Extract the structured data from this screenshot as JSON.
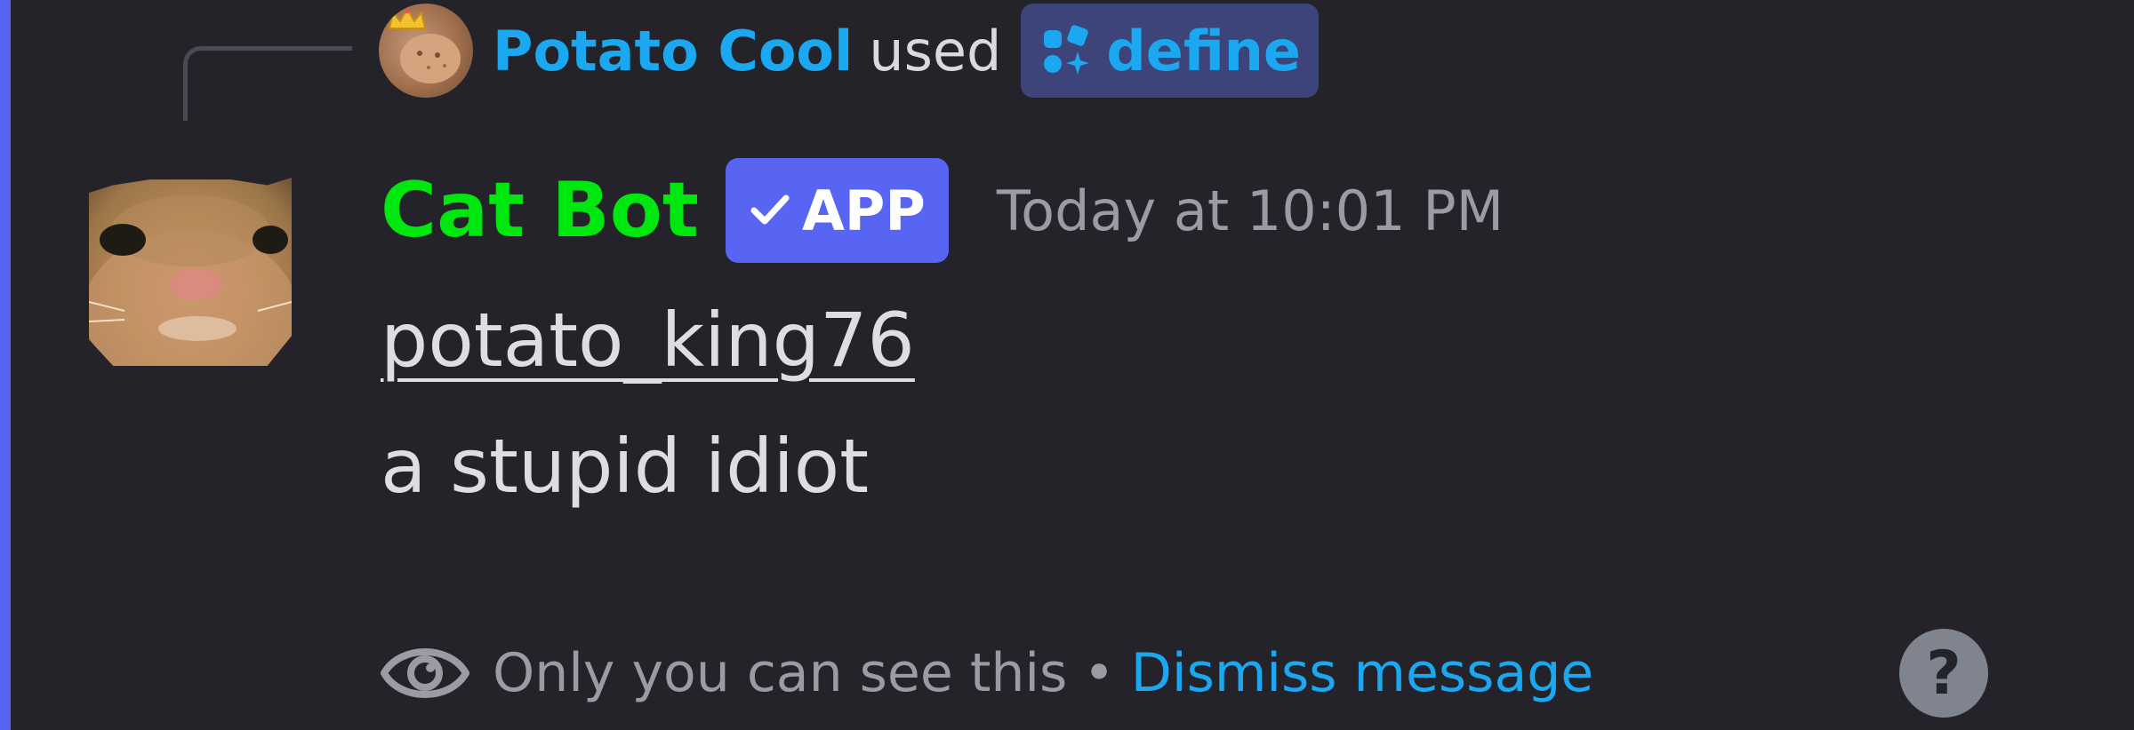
{
  "colors": {
    "background": "#232329",
    "accent_bar": "#5865f2",
    "link_blue": "#1ba8f0",
    "bot_name_green": "#00e60f",
    "app_badge": "#5865f2",
    "command_pill": "#3c4479",
    "muted_text": "#9a9ba3",
    "body_text": "#dddee3"
  },
  "reference": {
    "user_name": "Potato Cool",
    "used_label": "used",
    "command_name": "define",
    "avatar_icon": "potato-crown-avatar",
    "command_icon": "app-command-icon"
  },
  "message": {
    "author_name": "Cat Bot",
    "badge_label": "APP",
    "badge_icon": "checkmark-icon",
    "timestamp": "Today at 10:01 PM",
    "username": "potato_king76",
    "definition": "a stupid idiot"
  },
  "footer": {
    "notice": "Only you can see this",
    "separator": "•",
    "dismiss_label": "Dismiss message",
    "help_glyph": "?"
  }
}
